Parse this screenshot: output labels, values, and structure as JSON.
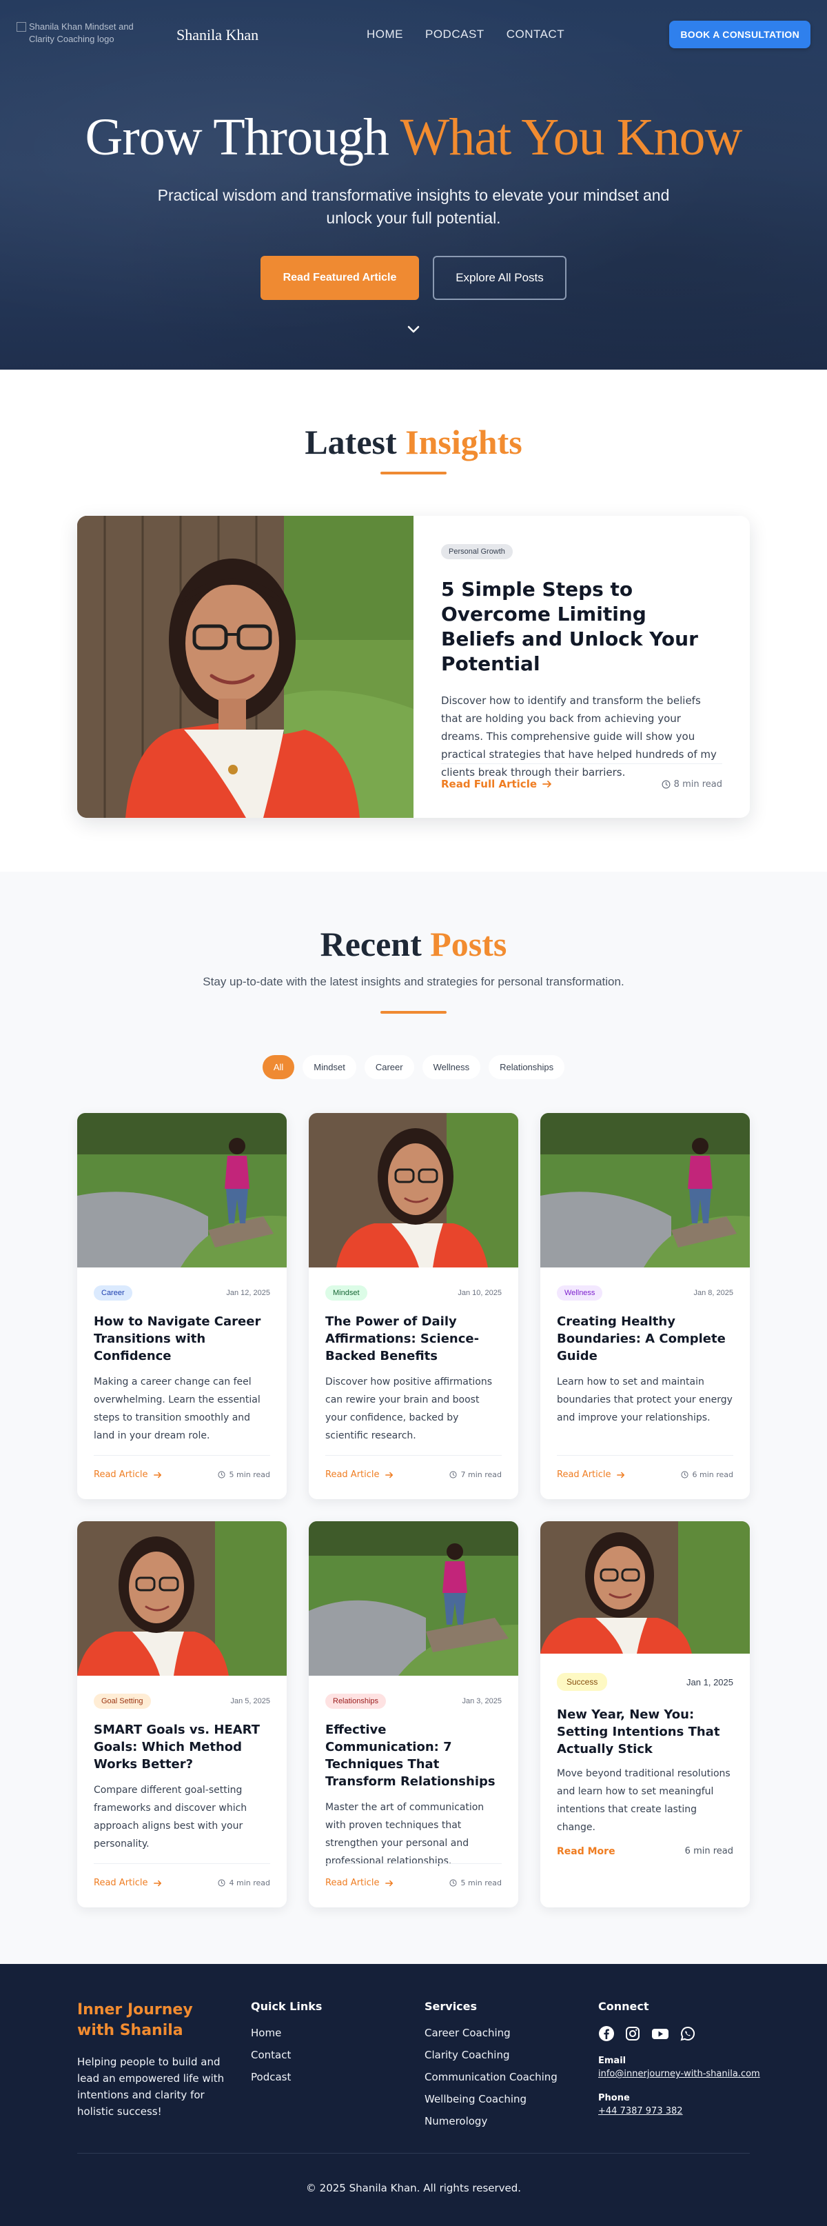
{
  "nav": {
    "logo_alt": "Shanila Khan Mindset and Clarity Coaching logo",
    "brand": "Shanila Khan",
    "links": [
      "HOME",
      "PODCAST",
      "CONTACT"
    ],
    "cta": "BOOK A CONSULTATION",
    "cta_color": "#2f80ed"
  },
  "hero": {
    "title_part1": "Grow Through",
    "title_part2": "What You Know",
    "subtitle": "Practical wisdom and transformative insights to elevate your mindset and unlock your full potential.",
    "primary_button": "Read Featured Article",
    "secondary_button": "Explore All Posts",
    "accent_color": "#f28c30",
    "scroll_icon": "chevron-down-icon"
  },
  "latest": {
    "title_part1": "Latest",
    "title_part2": "Insights",
    "featured": {
      "tag": "Personal Growth",
      "title": "5 Simple Steps to Overcome Limiting Beliefs and Unlock Your Potential",
      "description": "Discover how to identify and transform the beliefs that are holding you back from achieving your dreams. This comprehensive guide will show you practical strategies that have helped hundreds of my clients break through their barriers.",
      "link": "Read Full Article",
      "read_time": "8 min read"
    }
  },
  "recent": {
    "title_part1": "Recent",
    "title_part2": "Posts",
    "subtitle": "Stay up-to-date with the latest insights and strategies for personal transformation.",
    "filters": [
      "All",
      "Mindset",
      "Career",
      "Wellness",
      "Relationships"
    ],
    "active_filter": "All",
    "posts": [
      {
        "tag": "Career",
        "date": "Jan 12, 2025",
        "title": "How to Navigate Career Transitions with Confidence",
        "description": "Making a career change can feel overwhelming. Learn the essential steps to transition smoothly and land in your dream role.",
        "link": "Read Article",
        "read_time": "5 min read"
      },
      {
        "tag": "Mindset",
        "date": "Jan 10, 2025",
        "title": "The Power of Daily Affirmations: Science-Backed Benefits",
        "description": "Discover how positive affirmations can rewire your brain and boost your confidence, backed by scientific research.",
        "link": "Read Article",
        "read_time": "7 min read"
      },
      {
        "tag": "Wellness",
        "date": "Jan 8, 2025",
        "title": "Creating Healthy Boundaries: A Complete Guide",
        "description": "Learn how to set and maintain boundaries that protect your energy and improve your relationships.",
        "link": "Read Article",
        "read_time": "6 min read"
      },
      {
        "tag": "Goal Setting",
        "date": "Jan 5, 2025",
        "title": "SMART Goals vs. HEART Goals: Which Method Works Better?",
        "description": "Compare different goal-setting frameworks and discover which approach aligns best with your personality.",
        "link": "Read Article",
        "read_time": "4 min read"
      },
      {
        "tag": "Relationships",
        "date": "Jan 3, 2025",
        "title": "Effective Communication: 7 Techniques That Transform Relationships",
        "description": "Master the art of communication with proven techniques that strengthen your personal and professional relationships.",
        "link": "Read Article",
        "read_time": "5 min read"
      },
      {
        "tag": "Success",
        "date": "Jan 1, 2025",
        "title": "New Year, New You: Setting Intentions That Actually Stick",
        "description": "Move beyond traditional resolutions and learn how to set meaningful intentions that create lasting change.",
        "link": "Read More",
        "read_time": "6 min read"
      }
    ]
  },
  "footer": {
    "brand": "Inner Journey with Shanila",
    "description": "Helping people to build and lead an empowered life with intentions and clarity for holistic success!",
    "quick_links_title": "Quick Links",
    "quick_links": [
      "Home",
      "Contact",
      "Podcast"
    ],
    "services_title": "Services",
    "services": [
      "Career Coaching",
      "Clarity Coaching",
      "Communication Coaching",
      "Wellbeing Coaching",
      "Numerology"
    ],
    "connect_title": "Connect",
    "social_icons": [
      "facebook-icon",
      "instagram-icon",
      "youtube-icon",
      "whatsapp-icon"
    ],
    "email_label": "Email",
    "email": "info@innerjourney-with-shanila.com",
    "phone_label": "Phone",
    "phone": "+44 7387 973 382",
    "copyright": "© 2025 Shanila Khan. All rights reserved."
  }
}
